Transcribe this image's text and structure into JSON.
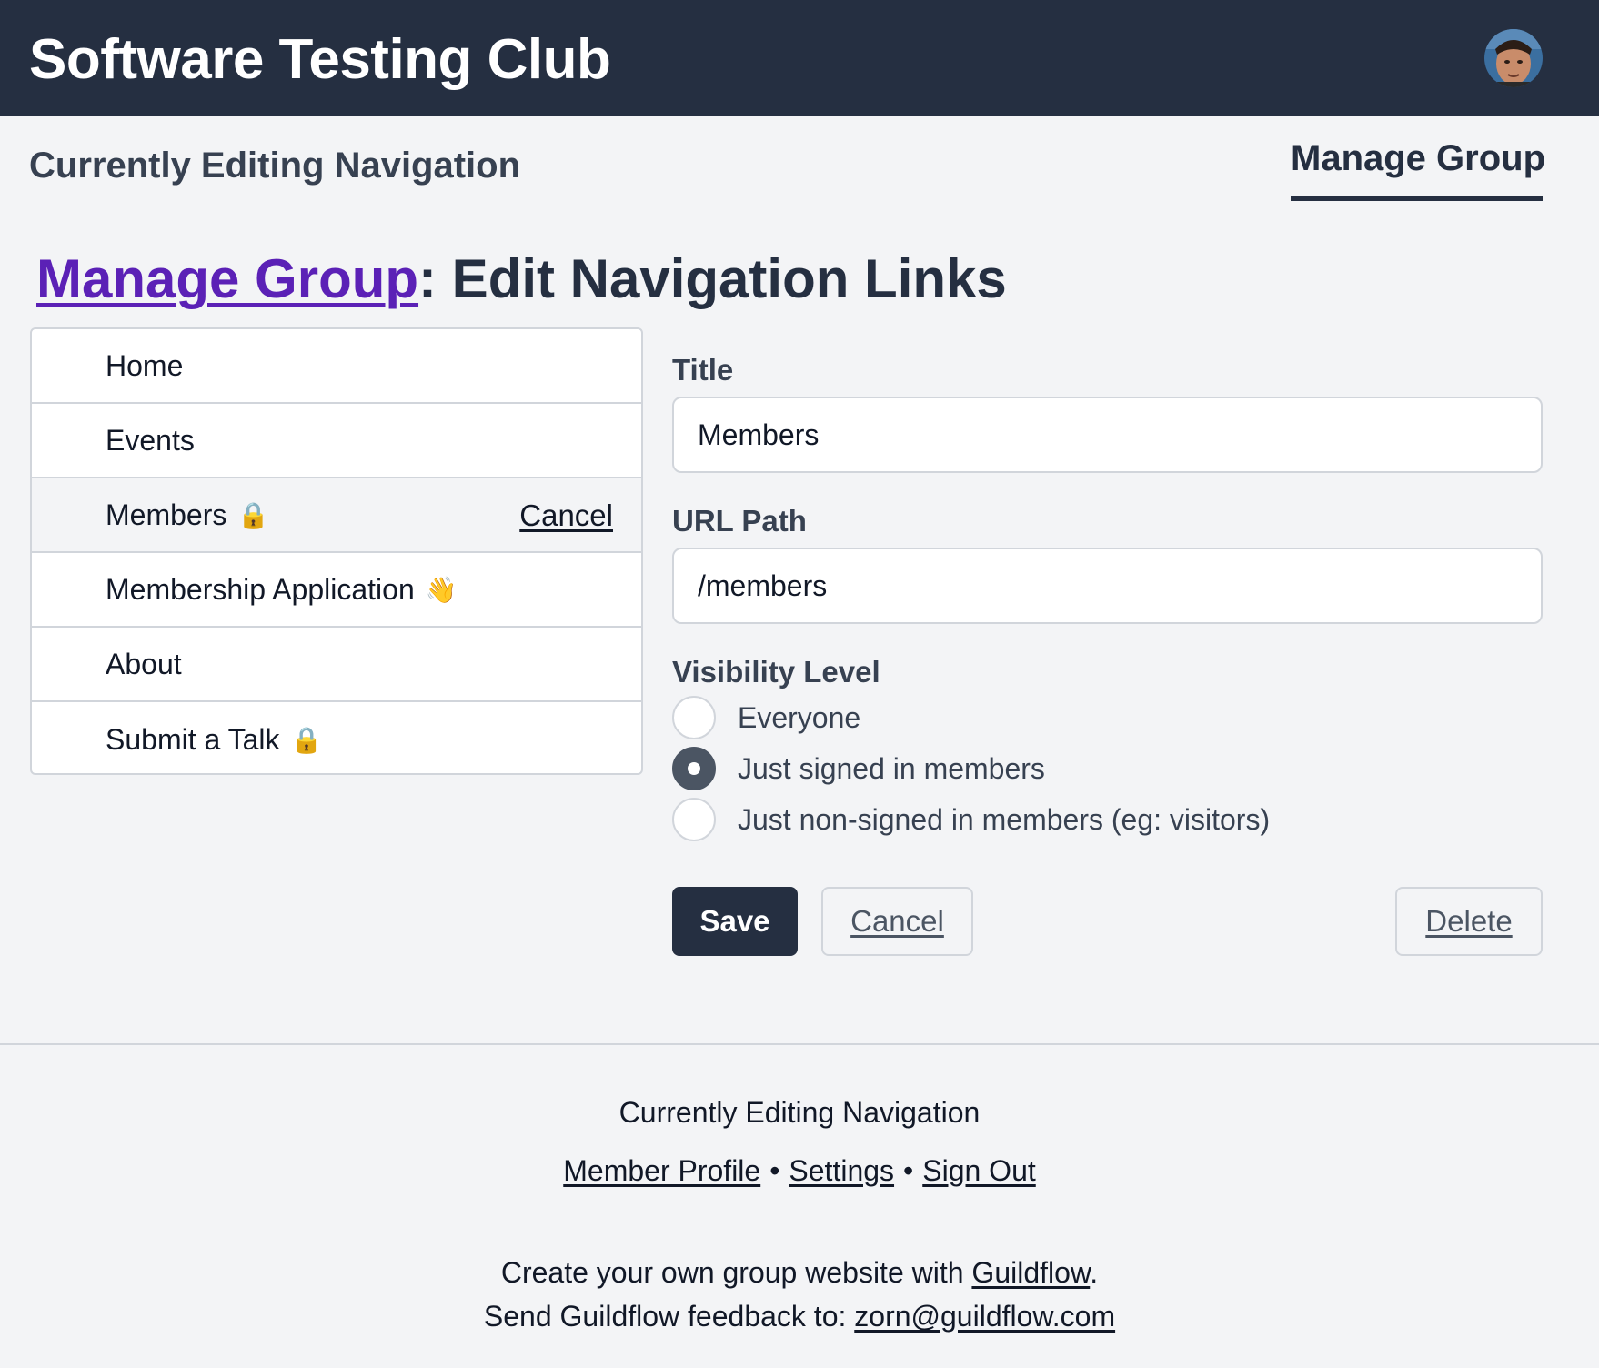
{
  "header": {
    "site_title": "Software Testing Club",
    "avatar_icon": "user-avatar"
  },
  "subheader": {
    "title": "Currently Editing Navigation",
    "tab": "Manage Group"
  },
  "page": {
    "heading_link": "Manage Group",
    "heading_rest": ": Edit Navigation Links"
  },
  "nav_links": {
    "items": [
      {
        "label": "Home",
        "emoji": ""
      },
      {
        "label": "Events",
        "emoji": ""
      },
      {
        "label": "Members",
        "emoji": "🔒",
        "action": "Cancel"
      },
      {
        "label": "Membership Application",
        "emoji": "👋"
      },
      {
        "label": "About",
        "emoji": ""
      },
      {
        "label": "Submit a Talk",
        "emoji": "🔒"
      }
    ]
  },
  "form": {
    "title_label": "Title",
    "title_value": "Members",
    "url_label": "URL Path",
    "url_value": "/members",
    "visibility_label": "Visibility Level",
    "visibility_options": [
      "Everyone",
      "Just signed in members",
      "Just non-signed in members (eg: visitors)"
    ],
    "visibility_selected": "Just signed in members",
    "save_label": "Save",
    "cancel_label": "Cancel",
    "delete_label": "Delete"
  },
  "footer": {
    "editing_text": "Currently Editing Navigation",
    "links": [
      "Member Profile",
      "Settings",
      "Sign Out"
    ],
    "separator": "•",
    "promo_prefix": "Create your own group website with ",
    "promo_link": "Guildflow",
    "promo_suffix": ".",
    "feedback_prefix": "Send Guildflow feedback to: ",
    "feedback_email": "zorn@guildflow.com"
  },
  "colors": {
    "header_bg": "#252f41",
    "link_purple": "#5b21b6",
    "page_bg": "#f3f4f6"
  }
}
